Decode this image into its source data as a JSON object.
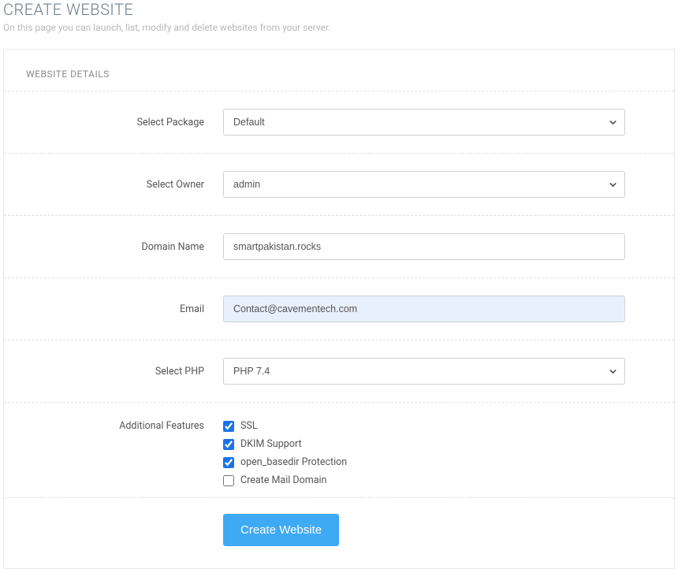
{
  "header": {
    "title": "CREATE WEBSITE",
    "subtitle": "On this page you can launch, list, modify and delete websites from your server."
  },
  "panel": {
    "title": "WEBSITE DETAILS"
  },
  "form": {
    "package": {
      "label": "Select Package",
      "value": "Default"
    },
    "owner": {
      "label": "Select Owner",
      "value": "admin"
    },
    "domain": {
      "label": "Domain Name",
      "value": "smartpakistan.rocks"
    },
    "email": {
      "label": "Email",
      "value": "Contact@cavementech.com"
    },
    "php": {
      "label": "Select PHP",
      "value": "PHP 7.4"
    },
    "features": {
      "label": "Additional Features",
      "items": [
        {
          "label": "SSL",
          "checked": true
        },
        {
          "label": "DKIM Support",
          "checked": true
        },
        {
          "label": "open_basedir Protection",
          "checked": true
        },
        {
          "label": "Create Mail Domain",
          "checked": false
        }
      ]
    },
    "submit_label": "Create Website"
  }
}
